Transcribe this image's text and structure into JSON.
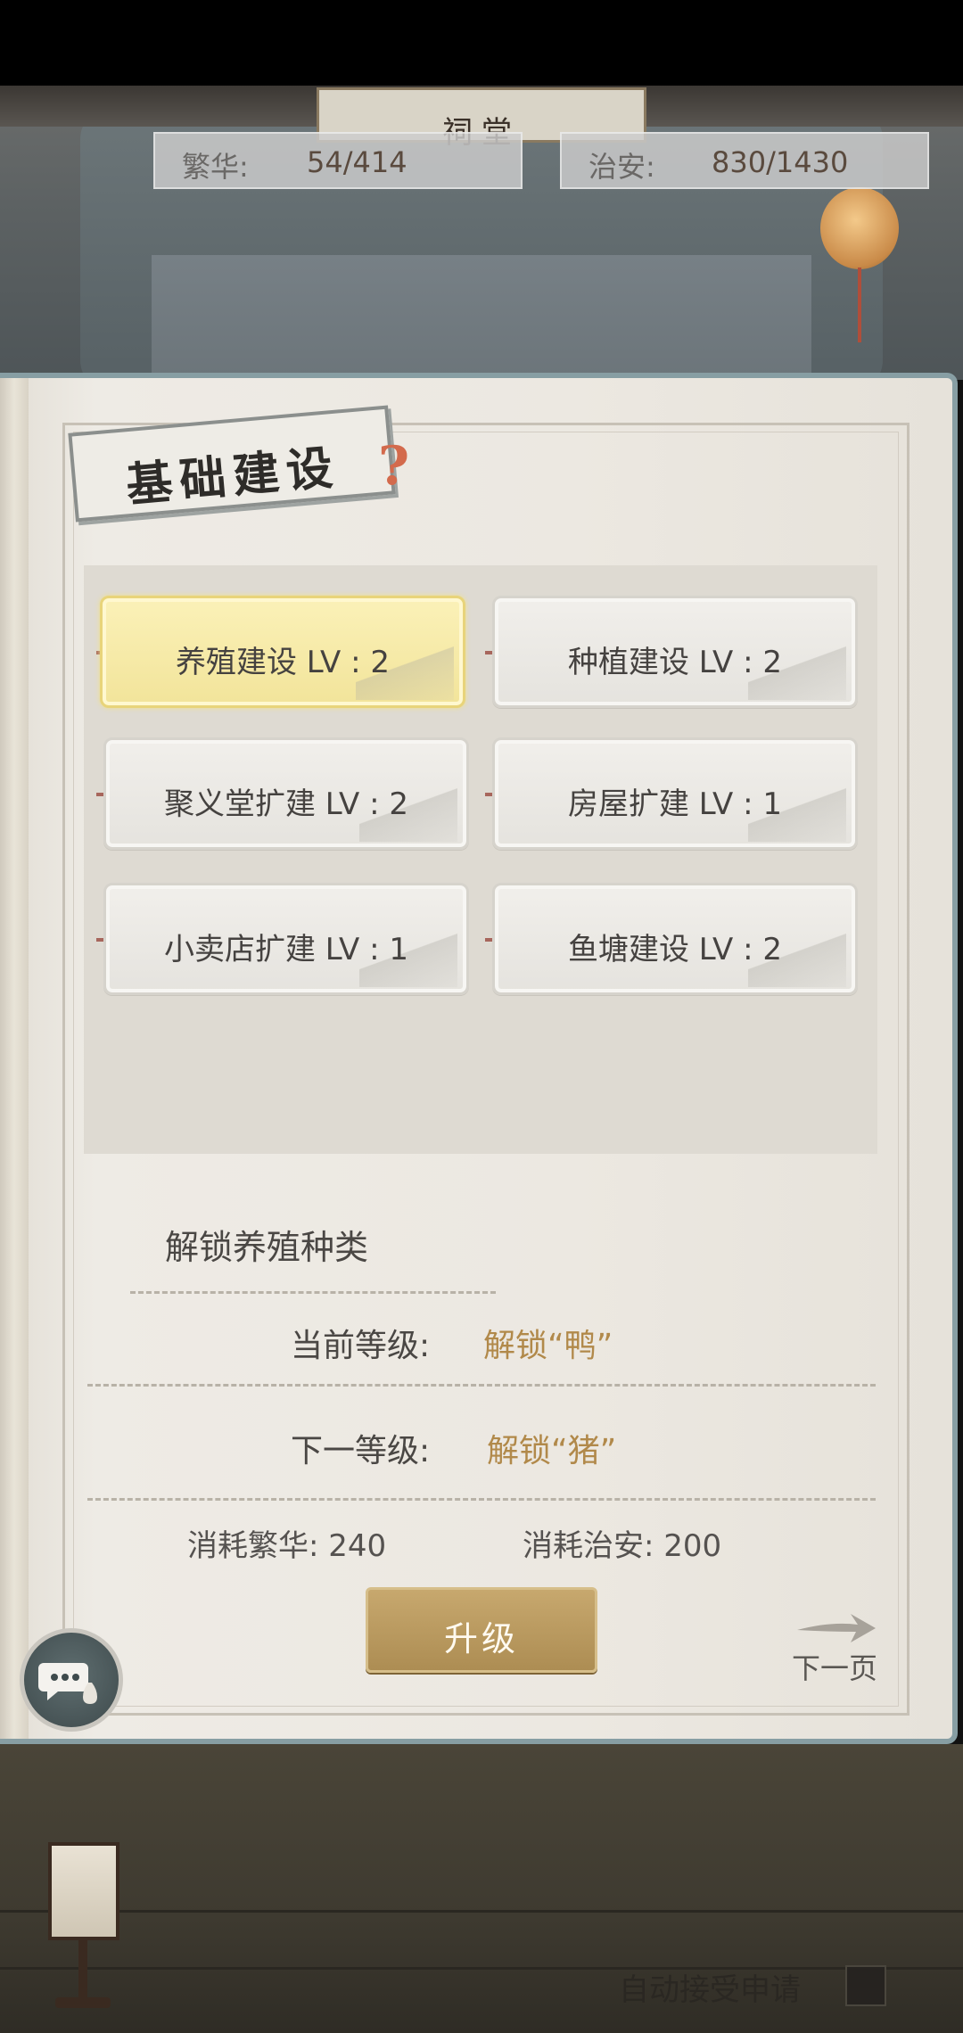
{
  "header": {
    "hall_plaque": "祠堂",
    "stats": [
      {
        "label": "繁华:",
        "value": "54/414"
      },
      {
        "label": "治安:",
        "value": "830/1430"
      }
    ]
  },
  "panel": {
    "title": "基础建设",
    "help_icon": "help-question-icon",
    "buildings": [
      {
        "label": "养殖建设 LV : 2",
        "selected": true
      },
      {
        "label": "种植建设 LV : 2",
        "selected": false
      },
      {
        "label": "聚义堂扩建 LV : 2",
        "selected": false
      },
      {
        "label": "房屋扩建 LV : 1",
        "selected": false
      },
      {
        "label": "小卖店扩建 LV : 1",
        "selected": false
      },
      {
        "label": "鱼塘建设 LV : 2",
        "selected": false
      }
    ],
    "detail": {
      "title": "解锁养殖种类",
      "current_label": "当前等级:",
      "current_value": "解锁“鸭”",
      "next_label": "下一等级:",
      "next_value": "解锁“猪”",
      "cost_prosperity_label": "消耗繁华:",
      "cost_prosperity_value": "240",
      "cost_security_label": "消耗治安:",
      "cost_security_value": "200"
    },
    "upgrade_button": "升级",
    "next_page": "下一页"
  },
  "footer": {
    "auto_accept_label": "自动接受申请"
  },
  "colors": {
    "accent_gold": "#b1894a",
    "selected_card": "#f7ecaa",
    "frame_blue": "#879ea3",
    "button_gold": "#bd9d62"
  }
}
